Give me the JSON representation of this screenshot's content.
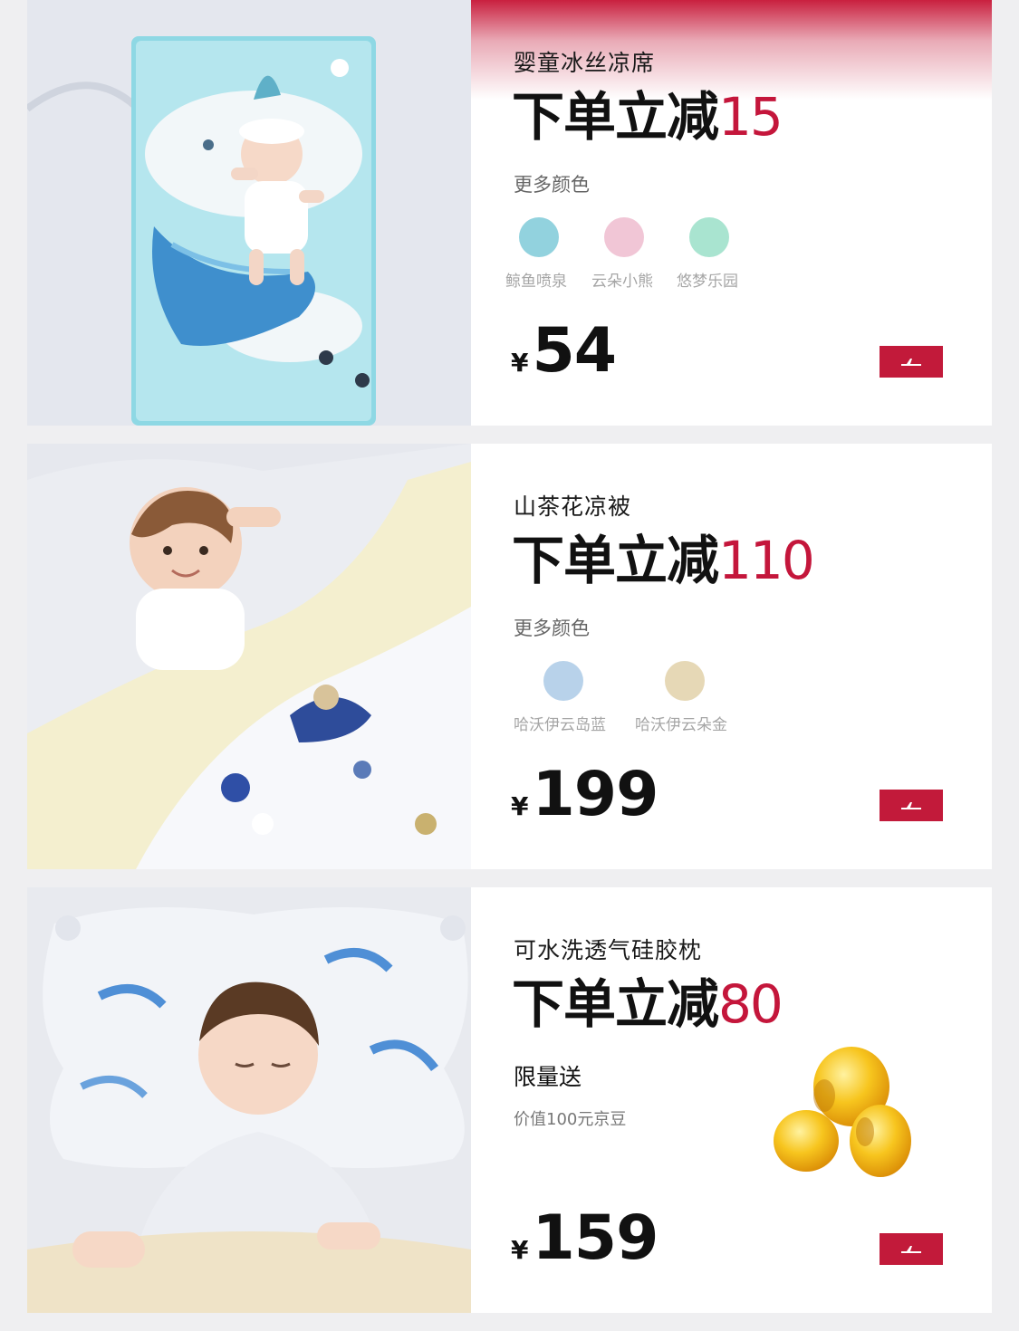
{
  "products": [
    {
      "name": "婴童冰丝凉席",
      "promo_prefix": "下单立减",
      "promo_amount": "15",
      "more_colors_label": "更多颜色",
      "swatches": [
        {
          "label": "鲸鱼喷泉",
          "color": "#92d2de"
        },
        {
          "label": "云朵小熊",
          "color": "#f1c6d6"
        },
        {
          "label": "悠梦乐园",
          "color": "#a9e4d0"
        }
      ],
      "currency": "¥",
      "price": "54",
      "buy_icon": "plane-icon"
    },
    {
      "name": "山茶花凉被",
      "promo_prefix": "下单立减",
      "promo_amount": "110",
      "more_colors_label": "更多颜色",
      "swatches": [
        {
          "label": "哈沃伊云岛蓝",
          "color": "#b8d2ea"
        },
        {
          "label": "哈沃伊云朵金",
          "color": "#e6d8b6"
        }
      ],
      "currency": "¥",
      "price": "199",
      "buy_icon": "plane-icon"
    },
    {
      "name": "可水洗透气硅胶枕",
      "promo_prefix": "下单立减",
      "promo_amount": "80",
      "gift_title": "限量送",
      "gift_desc": "价值100元京豆",
      "currency": "¥",
      "price": "159",
      "buy_icon": "plane-icon"
    }
  ],
  "colors": {
    "accent_red": "#c4163b",
    "button_red": "#c21a3a",
    "page_bg": "#efeff1"
  }
}
